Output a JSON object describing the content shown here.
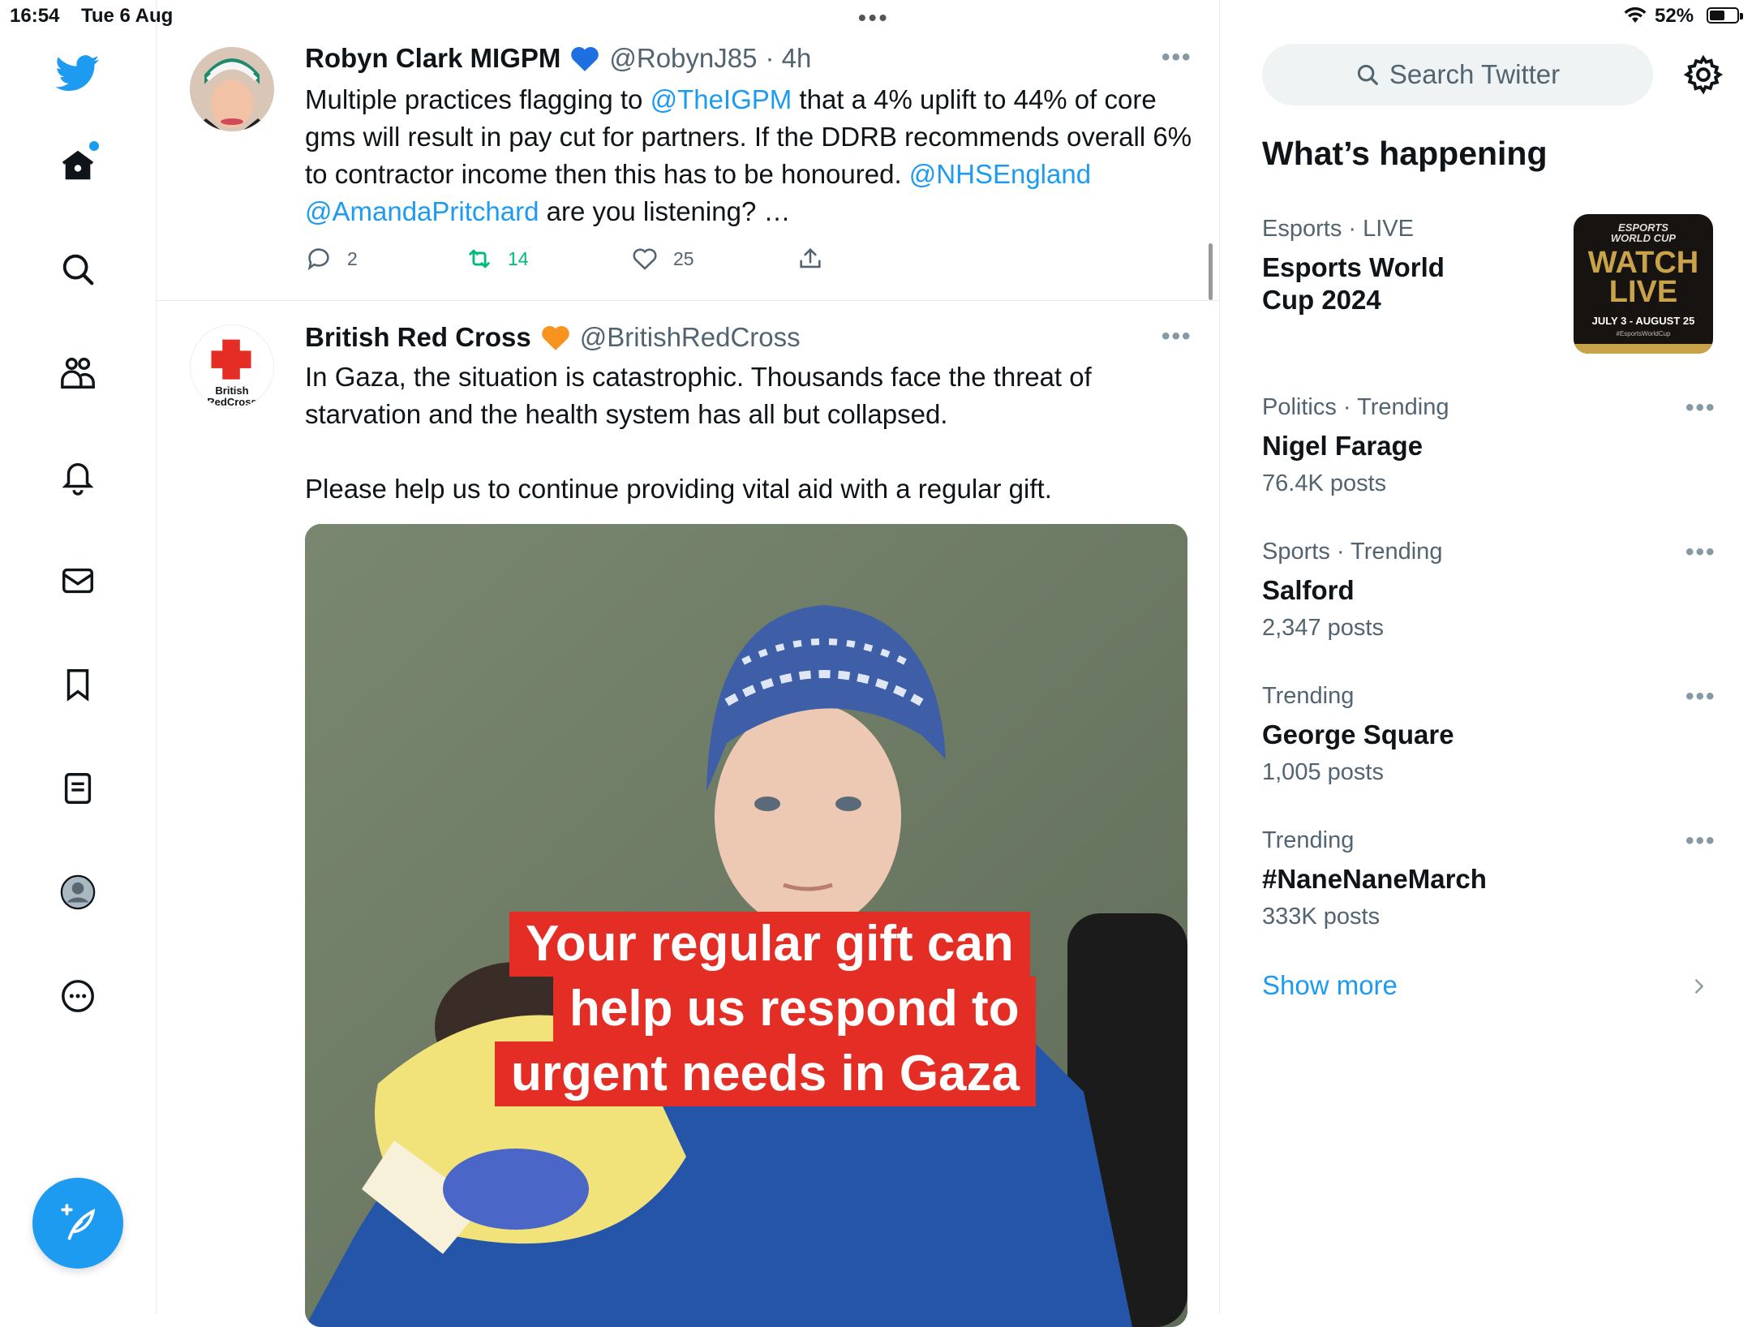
{
  "status_bar": {
    "time": "16:54",
    "date": "Tue 6 Aug",
    "center_dots": "•••",
    "battery": "52%"
  },
  "nav": {
    "items": [
      "twitter-logo",
      "home",
      "explore",
      "communities",
      "notifications",
      "messages",
      "bookmarks",
      "lists",
      "profile",
      "more"
    ],
    "accent": "#1d9bf0"
  },
  "tweets": [
    {
      "name": "Robyn Clark MIGPM",
      "badge": "blue-heart",
      "handle": "@RobynJ85",
      "time": "· 4h",
      "text_parts": {
        "t1": "Multiple practices flagging to ",
        "m1": "@TheIGPM",
        "t2": " that a 4% uplift to 44% of core gms will result in pay cut for partners. If the DDRB recommends overall 6% to contractor income then this has to be honoured. ",
        "m2": "@NHSEngland",
        "m3": "@AmandaPritchard",
        "t3": " are you listening? …"
      },
      "replies": "2",
      "retweets": "14",
      "likes": "25"
    },
    {
      "name": "British Red Cross",
      "badge": "orange-heart",
      "handle": "@BritishRedCross",
      "avatar_label_1": "British",
      "avatar_label_2": "RedCross",
      "text_1": "In Gaza, the situation is catastrophic. Thousands face the threat of starvation and the health system has all but collapsed.",
      "text_2": "Please help us to continue providing vital aid with a regular gift.",
      "image_overlay": [
        "Your regular gift can",
        "help us respond to",
        "urgent needs in Gaza"
      ]
    }
  ],
  "right": {
    "search_placeholder": "Search Twitter",
    "section_title": "What’s happening",
    "promo": {
      "meta_category": "Esports",
      "meta_status": "· LIVE",
      "name_line1": "Esports World",
      "name_line2": "Cup 2024",
      "thumb_line1": "ESPORTS",
      "thumb_line2": "WORLD CUP",
      "thumb_line3": "WATCH",
      "thumb_line4": "LIVE",
      "thumb_dates": "JULY 3 - AUGUST 25",
      "thumb_tag": "#EsportsWorldCup"
    },
    "trends": [
      {
        "meta": "Politics · Trending",
        "name": "Nigel Farage",
        "count": "76.4K posts"
      },
      {
        "meta": "Sports · Trending",
        "name": "Salford",
        "count": "2,347 posts"
      },
      {
        "meta": "Trending",
        "name": "George Square",
        "count": "1,005 posts"
      },
      {
        "meta": "Trending",
        "name": "#NaneNaneMarch",
        "count": "333K posts"
      }
    ],
    "show_more": "Show more"
  }
}
